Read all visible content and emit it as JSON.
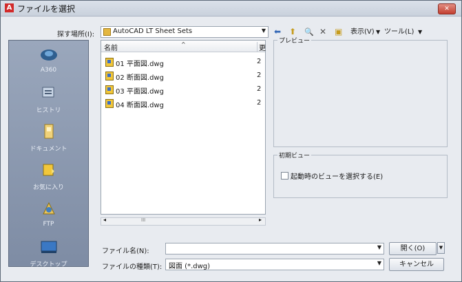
{
  "titlebar": {
    "app_icon": "A",
    "title": "ファイルを選択",
    "close": "✕"
  },
  "lookin": {
    "label": "探す場所(I):",
    "value": "AutoCAD LT Sheet Sets"
  },
  "toolbar": {
    "back": "⬅",
    "up": "⬆",
    "search": "🔍",
    "delete": "✕",
    "newfolder": "▣",
    "views": "表示(V)",
    "tools": "ツール(L)"
  },
  "places": [
    {
      "label": "A360",
      "icon": "cloud-icon"
    },
    {
      "label": "ヒストリ",
      "icon": "history-icon"
    },
    {
      "label": "ドキュメント",
      "icon": "documents-icon"
    },
    {
      "label": "お気に入り",
      "icon": "favorites-icon"
    },
    {
      "label": "FTP",
      "icon": "ftp-icon"
    },
    {
      "label": "デスクトップ",
      "icon": "desktop-icon"
    }
  ],
  "files": {
    "col_name": "名前",
    "col_sort": "^",
    "col_next": "更",
    "items": [
      {
        "name": "01 平面図.dwg",
        "col2": "2"
      },
      {
        "name": "02 断面図.dwg",
        "col2": "2"
      },
      {
        "name": "03 平面図.dwg",
        "col2": "2"
      },
      {
        "name": "04 断面図.dwg",
        "col2": "2"
      }
    ],
    "hscroll_thumb": "III"
  },
  "preview": {
    "legend": "プレビュー"
  },
  "initview": {
    "legend": "初期ビュー",
    "checkbox_label": "起動時のビューを選択する(E)"
  },
  "filename": {
    "label": "ファイル名(N):",
    "value": ""
  },
  "filetype": {
    "label": "ファイルの種類(T):",
    "value": "図面 (*.dwg)"
  },
  "buttons": {
    "open": "開く(O)",
    "cancel": "キャンセル"
  }
}
